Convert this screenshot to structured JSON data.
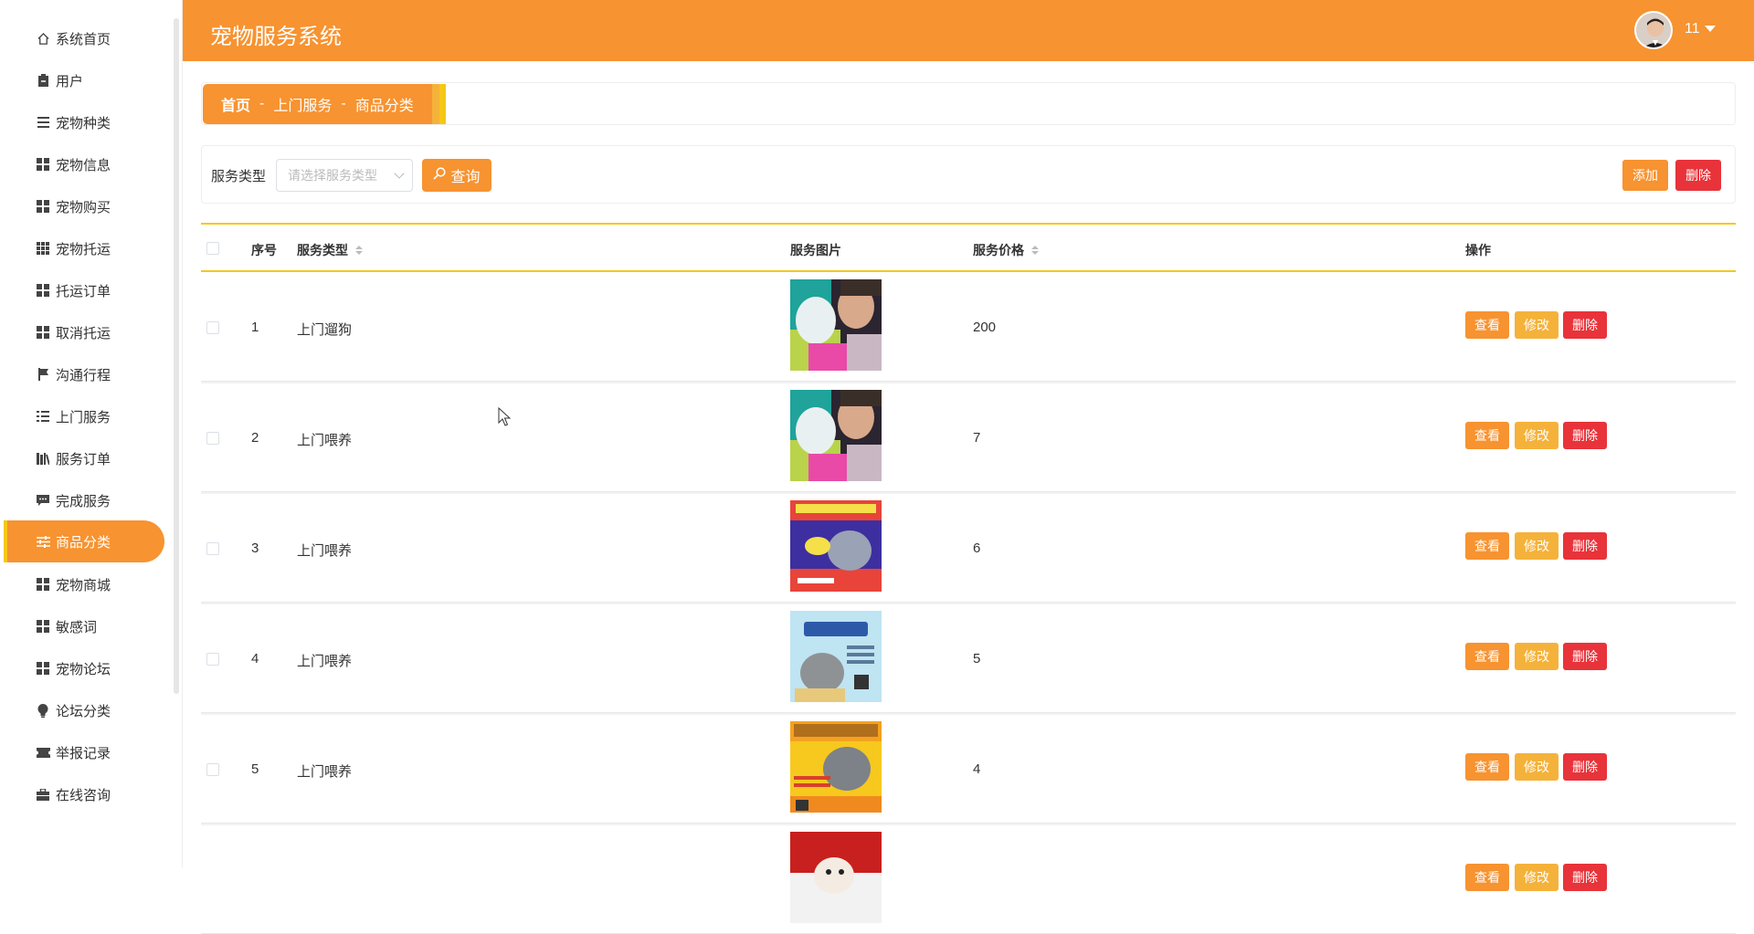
{
  "app": {
    "title": "宠物服务系统"
  },
  "user": {
    "name": "11"
  },
  "sidebar": {
    "items": [
      {
        "label": "系统首页",
        "icon": "home-icon"
      },
      {
        "label": "用户",
        "icon": "clipboard-icon"
      },
      {
        "label": "宠物种类",
        "icon": "menu-lines-icon"
      },
      {
        "label": "宠物信息",
        "icon": "grid-icon"
      },
      {
        "label": "宠物购买",
        "icon": "grid-icon"
      },
      {
        "label": "宠物托运",
        "icon": "grid9-icon"
      },
      {
        "label": "托运订单",
        "icon": "grid-icon"
      },
      {
        "label": "取消托运",
        "icon": "grid-icon"
      },
      {
        "label": "沟通行程",
        "icon": "flag-icon"
      },
      {
        "label": "上门服务",
        "icon": "list-icon"
      },
      {
        "label": "服务订单",
        "icon": "books-icon"
      },
      {
        "label": "完成服务",
        "icon": "chat-icon"
      },
      {
        "label": "商品分类",
        "icon": "sliders-icon",
        "active": true
      },
      {
        "label": "宠物商城",
        "icon": "grid-icon"
      },
      {
        "label": "敏感词",
        "icon": "grid-icon"
      },
      {
        "label": "宠物论坛",
        "icon": "grid-icon"
      },
      {
        "label": "论坛分类",
        "icon": "bulb-icon"
      },
      {
        "label": "举报记录",
        "icon": "ticket-icon"
      },
      {
        "label": "在线咨询",
        "icon": "briefcase-icon"
      }
    ]
  },
  "breadcrumb": {
    "home": "首页",
    "sep": "-",
    "parent": "上门服务",
    "current": "商品分类"
  },
  "search": {
    "label": "服务类型",
    "placeholder": "请选择服务类型",
    "query_label": "查询",
    "add_label": "添加",
    "delete_label": "删除"
  },
  "table": {
    "headers": {
      "index": "序号",
      "type": "服务类型",
      "image": "服务图片",
      "price": "服务价格",
      "actions": "操作"
    },
    "action_labels": {
      "view": "查看",
      "edit": "修改",
      "delete": "删除"
    },
    "rows": [
      {
        "index": "1",
        "type": "上门遛狗",
        "price": "200",
        "image": "dog-grooming"
      },
      {
        "index": "2",
        "type": "上门喂养",
        "price": "7",
        "image": "dog-grooming"
      },
      {
        "index": "3",
        "type": "上门喂养",
        "price": "6",
        "image": "cat-poster"
      },
      {
        "index": "4",
        "type": "上门喂养",
        "price": "5",
        "image": "pet-home-poster"
      },
      {
        "index": "5",
        "type": "上门喂养",
        "price": "4",
        "image": "pet-shop-poster"
      },
      {
        "index": "",
        "type": "",
        "price": "",
        "image": "dog-red"
      }
    ]
  },
  "colors": {
    "primary": "#f79330",
    "accent": "#f5c816",
    "danger": "#e8333a",
    "warning": "#f5b23a"
  }
}
